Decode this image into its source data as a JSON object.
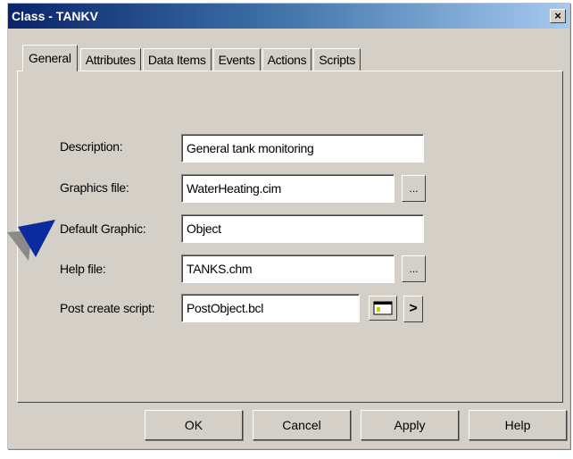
{
  "window": {
    "title": "Class - TANKV",
    "close_glyph": "×"
  },
  "tabs": [
    {
      "label": "General",
      "active": true
    },
    {
      "label": "Attributes"
    },
    {
      "label": "Data Items"
    },
    {
      "label": "Events"
    },
    {
      "label": "Actions"
    },
    {
      "label": "Scripts"
    }
  ],
  "fields": {
    "description": {
      "label": "Description:",
      "value": "General tank monitoring"
    },
    "graphics_file": {
      "label": "Graphics file:",
      "value": "WaterHeating.cim",
      "browse_label": "..."
    },
    "default_graphic": {
      "label": "Default Graphic:",
      "value": "Object"
    },
    "help_file": {
      "label": "Help file:",
      "value": "TANKS.chm",
      "browse_label": "..."
    },
    "post_create_script": {
      "label": "Post create script:",
      "value": "PostObject.bcl",
      "run_glyph": ">"
    }
  },
  "buttons": {
    "ok": "OK",
    "cancel": "Cancel",
    "apply": "Apply",
    "help": "Help"
  },
  "colors": {
    "face": "#d4d0c8",
    "title_start": "#0a246a",
    "title_end": "#a6caf0",
    "pointer": "#0a2a9e"
  }
}
